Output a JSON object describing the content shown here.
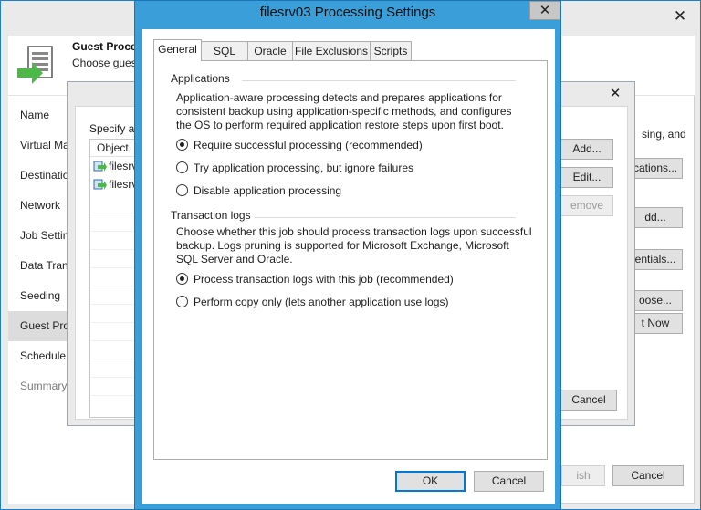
{
  "wizard": {
    "header_title": "Guest Proces",
    "header_subtitle": "Choose guest",
    "nav": [
      {
        "label": "Name"
      },
      {
        "label": "Virtual Ma"
      },
      {
        "label": "Destinatio"
      },
      {
        "label": "Network"
      },
      {
        "label": "Job Settin"
      },
      {
        "label": "Data Tran"
      },
      {
        "label": "Seeding"
      },
      {
        "label": "Guest Pro"
      },
      {
        "label": "Schedule"
      },
      {
        "label": "Summary"
      }
    ],
    "right_text": "sing, and",
    "buttons": {
      "applications": "cations...",
      "add": "dd...",
      "credentials": "entials...",
      "choose": "oose...",
      "test_now": "t Now",
      "finish": "ish",
      "cancel": "Cancel"
    }
  },
  "mid_dialog": {
    "label": "Specify ap",
    "list_header": "Object",
    "rows": [
      "filesrv",
      "filesrv"
    ],
    "buttons": {
      "add": "Add...",
      "edit": "Edit...",
      "remove": "emove",
      "cancel": "Cancel"
    }
  },
  "dialog": {
    "title": "filesrv03 Processing Settings",
    "tabs": [
      "General",
      "SQL",
      "Oracle",
      "File Exclusions",
      "Scripts"
    ],
    "applications": {
      "title": "Applications",
      "description_lines": [
        "Application-aware processing detects and prepares applications for",
        "consistent backup using application-specific methods, and configures",
        "the OS to perform required application restore steps upon first boot."
      ],
      "options": [
        "Require successful processing  (recommended)",
        "Try application processing, but ignore failures",
        "Disable application processing"
      ]
    },
    "transaction_logs": {
      "title": "Transaction logs",
      "description_lines": [
        "Choose whether this job should process transaction logs upon successful",
        "backup. Logs pruning is supported for Microsoft Exchange, Microsoft",
        "SQL Server and Oracle."
      ],
      "options": [
        "Process transaction logs with this job (recommended)",
        "Perform copy only (lets another application use logs)"
      ]
    },
    "ok": "OK",
    "cancel": "Cancel"
  }
}
